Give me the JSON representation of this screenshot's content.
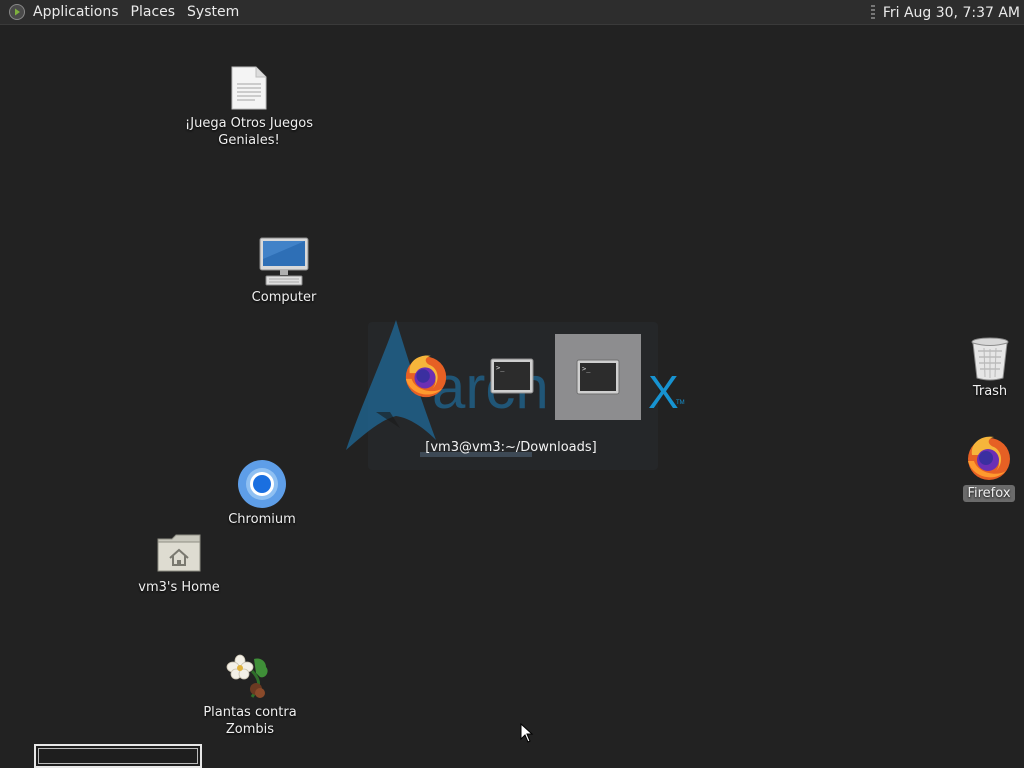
{
  "topbar": {
    "menu": [
      "Applications",
      "Places",
      "System"
    ],
    "clock": "Fri Aug 30,  7:37 AM"
  },
  "desktop_icons": [
    {
      "label": "¡Juega Otros Juegos Geniales!",
      "icon": "document-icon"
    },
    {
      "label": "Computer",
      "icon": "computer-icon"
    },
    {
      "label": "Chromium",
      "icon": "chromium-icon"
    },
    {
      "label": "vm3's Home",
      "icon": "home-folder-icon"
    },
    {
      "label": "Plantas contra Zombis",
      "icon": "plants-vs-zombies-icon"
    },
    {
      "label": "Trash",
      "icon": "trash-icon"
    },
    {
      "label": "Firefox",
      "icon": "firefox-icon"
    }
  ],
  "switcher": {
    "title": "[vm3@vm3:~/Downloads]",
    "windows": [
      "firefox-icon",
      "terminal-icon",
      "terminal-icon"
    ]
  },
  "colors": {
    "background": "#222222",
    "arch_blue": "#1793d1",
    "selected": "#8d8d8f"
  }
}
